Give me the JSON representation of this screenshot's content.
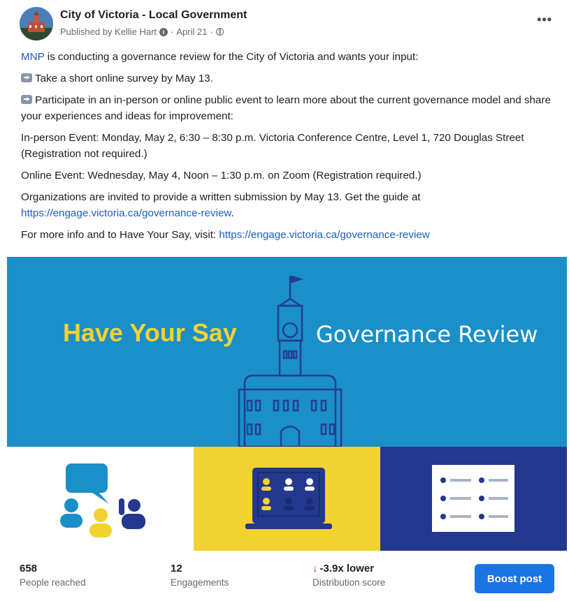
{
  "post": {
    "page_name": "City of Victoria - Local Government",
    "published_by": "Published by Kellie Hart",
    "date": "April 21",
    "more_label": "•••",
    "icons": {
      "info": "info-circle-icon",
      "audience": "globe-icon",
      "avatar": "city-hall-avatar"
    }
  },
  "content": {
    "intro_link": "MNP",
    "intro_rest": " is conducting a governance review for the City of Victoria and wants your input:",
    "bullet1": "Take a short online survey by May 13.",
    "bullet2": "Participate in an in-person or online public event to learn more about the current governance model and share your experiences and ideas for improvement:",
    "in_person": "In-person Event: Monday, May 2, 6:30 – 8:30 p.m. Victoria Conference Centre, Level 1, 720 Douglas Street (Registration not required.)",
    "online": "Online Event: Wednesday, May 4, Noon – 1:30 p.m. on Zoom (Registration required.)",
    "orgs_text": "Organizations are invited to provide a written submission by May 13. Get the guide at",
    "orgs_link": "https://engage.victoria.ca/governance-review",
    "orgs_end": ".",
    "more_info_text": "For more info and to Have Your Say, visit: ",
    "more_info_link": "https://engage.victoria.ca/governance-review"
  },
  "banner": {
    "headline_left": "Have Your Say",
    "headline_right": "Governance Review",
    "colors": {
      "blue": "#1b8fc7",
      "yellow": "#f2d22e",
      "navy": "#23388e",
      "headline_yellow": "#f5d233"
    }
  },
  "stats": {
    "reached_value": "658",
    "reached_label": "People reached",
    "engagements_value": "12",
    "engagements_label": "Engagements",
    "distribution_value": "-3.9x lower",
    "distribution_arrow": "↓",
    "distribution_label": "Distribution score",
    "boost_label": "Boost post",
    "colors": {
      "boost": "#1b74e4",
      "down": "#e41e3f"
    }
  }
}
